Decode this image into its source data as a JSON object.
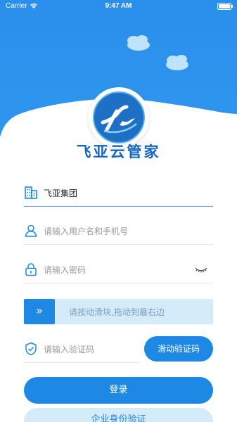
{
  "status_bar": {
    "carrier": "Carrier",
    "time": "9:47 AM",
    "wifi_icon": "wifi-icon",
    "battery_icon": "battery-icon"
  },
  "app": {
    "title": "飞亚云管家",
    "logo_icon": "app-logo-icon"
  },
  "colors": {
    "brand_blue": "#1e88e5",
    "light_blue": "#d4ebfa",
    "header_blue": "#2d92ec"
  },
  "form": {
    "company": {
      "icon": "building-icon",
      "value": "飞亚集团"
    },
    "username": {
      "icon": "user-icon",
      "placeholder": "请输入用户名和手机号"
    },
    "password": {
      "icon": "lock-icon",
      "placeholder": "请输入密码",
      "toggle_icon": "eye-closed-icon"
    },
    "slider": {
      "handle_icon": "double-chevron-right-icon",
      "handle_text": "»",
      "hint": "请按动滑块,拖动到最右边"
    },
    "captcha": {
      "icon": "shield-check-icon",
      "placeholder": "请输入验证码",
      "button_label": "滑动验证码"
    },
    "login_label": "登录",
    "enterprise_label": "企业身份验证"
  }
}
